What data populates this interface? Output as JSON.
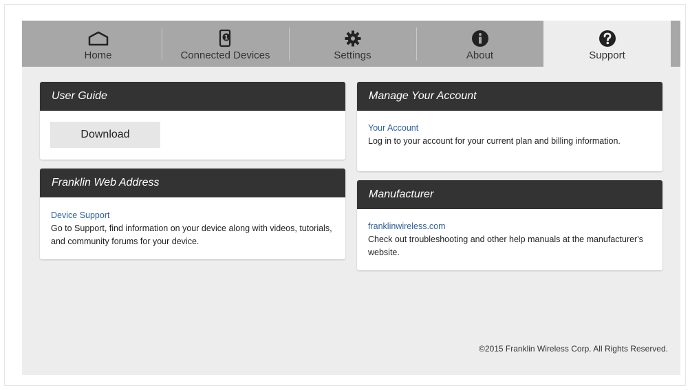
{
  "nav": {
    "tabs": [
      {
        "label": "Home",
        "icon": "home-icon"
      },
      {
        "label": "Connected Devices",
        "icon": "connected-devices-icon"
      },
      {
        "label": "Settings",
        "icon": "gear-icon"
      },
      {
        "label": "About",
        "icon": "info-icon"
      },
      {
        "label": "Support",
        "icon": "help-icon"
      }
    ],
    "active": "Support"
  },
  "user_guide": {
    "title": "User Guide",
    "button_label": "Download"
  },
  "web_address": {
    "title": "Franklin Web Address",
    "link": "Device Support",
    "text": "Go to Support, find information on your device along with videos, tutorials, and community forums for your device."
  },
  "account": {
    "title": "Manage Your Account",
    "link": "Your Account",
    "text": "Log in to your account for your current plan and billing information."
  },
  "manufacturer": {
    "title": "Manufacturer",
    "link": "franklinwireless.com",
    "text": "Check out troubleshooting and other help manuals at the manufacturer's website."
  },
  "footer": {
    "copyright": "©2015 Franklin Wireless Corp. All Rights Reserved."
  },
  "colors": {
    "nav_bg": "#a7a7a7",
    "page_bg": "#ededed",
    "panel_header": "#333333",
    "link": "#2f5f9e"
  }
}
